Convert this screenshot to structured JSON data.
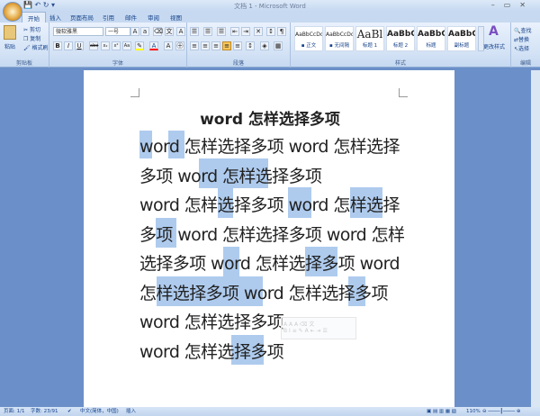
{
  "window": {
    "title": "文档 1 - Microsoft Word",
    "controls": [
      "–",
      "▭",
      "✕"
    ]
  },
  "qat": {
    "save": "💾",
    "undo": "↶",
    "redo": "↻",
    "more": "▾"
  },
  "tabs": [
    "开始",
    "插入",
    "页面布局",
    "引用",
    "邮件",
    "审阅",
    "视图"
  ],
  "clipboard": {
    "paste": "粘贴",
    "cut": "剪切",
    "copy": "复制",
    "format_painter": "格式刷",
    "label": "剪贴板"
  },
  "font": {
    "name": "微软雅黑",
    "size": "一号",
    "label": "字体",
    "buttons": [
      "B",
      "I",
      "U",
      "abe",
      "x₂",
      "x²",
      "Aa",
      "A"
    ]
  },
  "paragraph": {
    "label": "段落"
  },
  "styles": {
    "label": "样式",
    "items": [
      {
        "sample": "AaBbCcDd",
        "name": "▪ 正文"
      },
      {
        "sample": "AaBbCcDd",
        "name": "▪ 无间隔"
      },
      {
        "sample": "AaBl",
        "name": "标题 1"
      },
      {
        "sample": "AaBbC",
        "name": "标题 2"
      },
      {
        "sample": "AaBbC",
        "name": "标题"
      },
      {
        "sample": "AaBbC",
        "name": "副标题"
      }
    ],
    "change": "更改样式"
  },
  "editing": {
    "label": "编辑",
    "find": "查找",
    "replace": "替换",
    "select": "选择"
  },
  "document": {
    "title": "word 怎样选择多项",
    "lines": [
      "word 怎样选择多项 word 怎样选择",
      "多项 word 怎样选择多项",
      "word 怎样选择多项 word 怎样选择",
      "多项 word 怎样选择多项 word 怎样",
      "选择多项 word 怎样选择多项 word",
      "怎样选择多项  word  怎样选择多项",
      "word 怎样选择多项",
      "word 怎样选择多项"
    ]
  },
  "status": {
    "page": "页面: 1/1",
    "words": "字数: 23/91",
    "language": "中文(简体，中国)",
    "mode": "插入",
    "zoom": "110%"
  }
}
